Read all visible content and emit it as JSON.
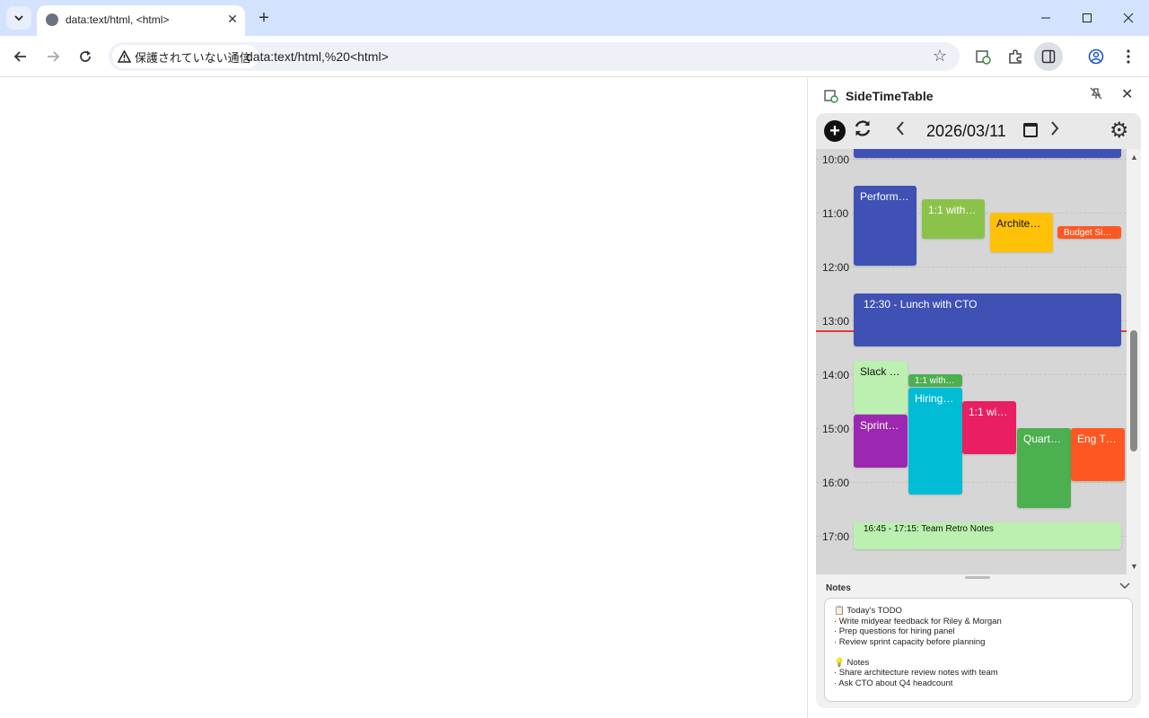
{
  "browser": {
    "tab_title": "data:text/html, <html>",
    "security_label": "保護されていない通信",
    "url": "data:text/html,%20<html>"
  },
  "side_panel": {
    "title": "SideTimeTable",
    "toolbar": {
      "date": "2026/03/11"
    },
    "hours": [
      "10:00",
      "11:00",
      "12:00",
      "13:00",
      "14:00",
      "15:00",
      "16:00",
      "17:00"
    ],
    "events": [
      {
        "label": "",
        "color": "#3f51b5"
      },
      {
        "label": "Perform…",
        "color": "#3f51b5"
      },
      {
        "label": "1:1 with…",
        "color": "#8bc34a"
      },
      {
        "label": "Archite…",
        "color": "#ffc107"
      },
      {
        "label": "Budget Si…",
        "color": "#ff5722"
      },
      {
        "label": "12:30 - Lunch with CTO",
        "color": "#3f51b5"
      },
      {
        "label": "Slack …",
        "color": "#bbf0b0"
      },
      {
        "label": "1:1 with …",
        "color": "#4caf50"
      },
      {
        "label": "Hiring …",
        "color": "#00bcd4"
      },
      {
        "label": "1:1 wit…",
        "color": "#e91e63"
      },
      {
        "label": "Sprint …",
        "color": "#9c27b0"
      },
      {
        "label": "Quart…",
        "color": "#4caf50"
      },
      {
        "label": "Eng T…",
        "color": "#ff5722"
      },
      {
        "label": "16:45 - 17:15: Team Retro Notes",
        "color": "#bbf0b0"
      }
    ],
    "notes": {
      "header": "Notes",
      "lines": [
        "📋 Today's TODO",
        "· Write midyear feedback for Riley & Morgan",
        "· Prep questions for hiring panel",
        "· Review sprint capacity before planning",
        "",
        "💡 Notes",
        "· Share architecture review notes with team",
        "· Ask CTO about Q4 headcount"
      ]
    }
  }
}
